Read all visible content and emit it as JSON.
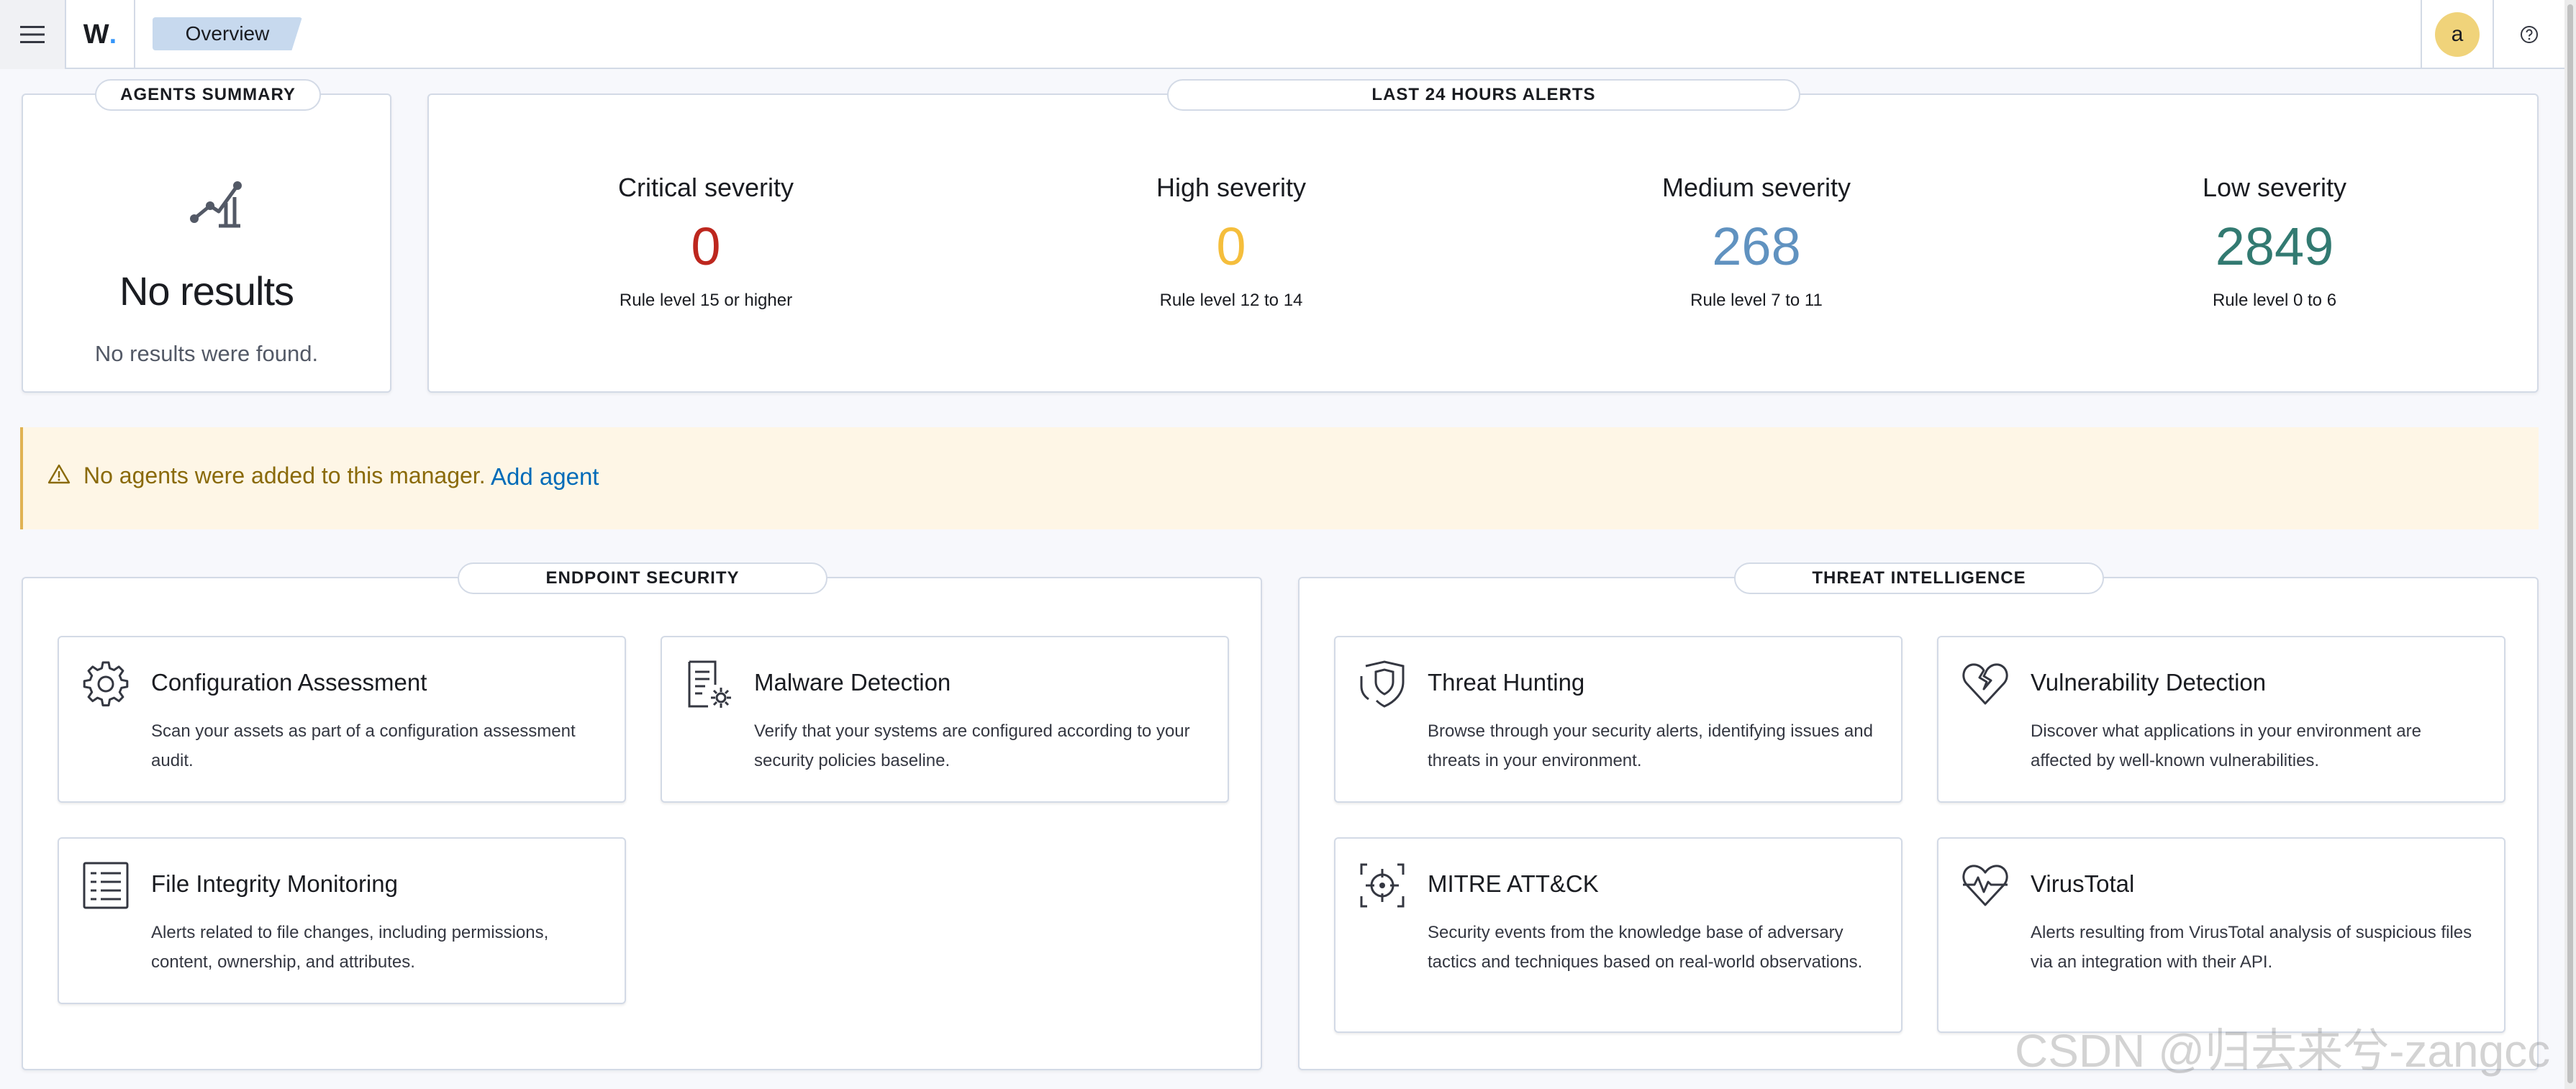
{
  "header": {
    "logo_text": "W",
    "breadcrumb": "Overview",
    "avatar_initial": "a",
    "icons": [
      "menu-icon",
      "help-icon"
    ]
  },
  "agents_summary": {
    "title": "AGENTS SUMMARY",
    "empty_title": "No results",
    "empty_subtitle": "No results were found.",
    "icon": "chart-line-icon"
  },
  "alerts": {
    "title": "LAST 24 HOURS ALERTS",
    "severities": [
      {
        "label": "Critical severity",
        "value": "0",
        "rule": "Rule level 15 or higher",
        "color": "#bd271e"
      },
      {
        "label": "High severity",
        "value": "0",
        "rule": "Rule level 12 to 14",
        "color": "#f5be3c"
      },
      {
        "label": "Medium severity",
        "value": "268",
        "rule": "Rule level 7 to 11",
        "color": "#6092c0"
      },
      {
        "label": "Low severity",
        "value": "2849",
        "rule": "Rule level 0 to 6",
        "color": "#327a71"
      }
    ]
  },
  "callout": {
    "message": "No agents were added to this manager.",
    "link": "Add agent",
    "icon": "warning-icon"
  },
  "endpoint_security": {
    "title": "ENDPOINT SECURITY",
    "cards": [
      {
        "title": "Configuration Assessment",
        "description": "Scan your assets as part of a configuration assessment audit.",
        "icon": "gear-icon"
      },
      {
        "title": "Malware Detection",
        "description": "Verify that your systems are configured according to your security policies baseline.",
        "icon": "document-gear-icon"
      },
      {
        "title": "File Integrity Monitoring",
        "description": "Alerts related to file changes, including permissions, content, ownership, and attributes.",
        "icon": "list-document-icon"
      }
    ]
  },
  "threat_intelligence": {
    "title": "THREAT INTELLIGENCE",
    "cards": [
      {
        "title": "Threat Hunting",
        "description": "Browse through your security alerts, identifying issues and threats in your environment.",
        "icon": "shield-icon"
      },
      {
        "title": "Vulnerability Detection",
        "description": "Discover what applications in your environment are affected by well-known vulnerabilities.",
        "icon": "broken-heart-icon"
      },
      {
        "title": "MITRE ATT&CK",
        "description": "Security events from the knowledge base of adversary tactics and techniques based on real-world observations.",
        "icon": "crosshair-icon"
      },
      {
        "title": "VirusTotal",
        "description": "Alerts resulting from VirusTotal analysis of suspicious files via an integration with their API.",
        "icon": "heartbeat-icon"
      }
    ]
  },
  "watermark": "CSDN @归去来兮-zangcc"
}
